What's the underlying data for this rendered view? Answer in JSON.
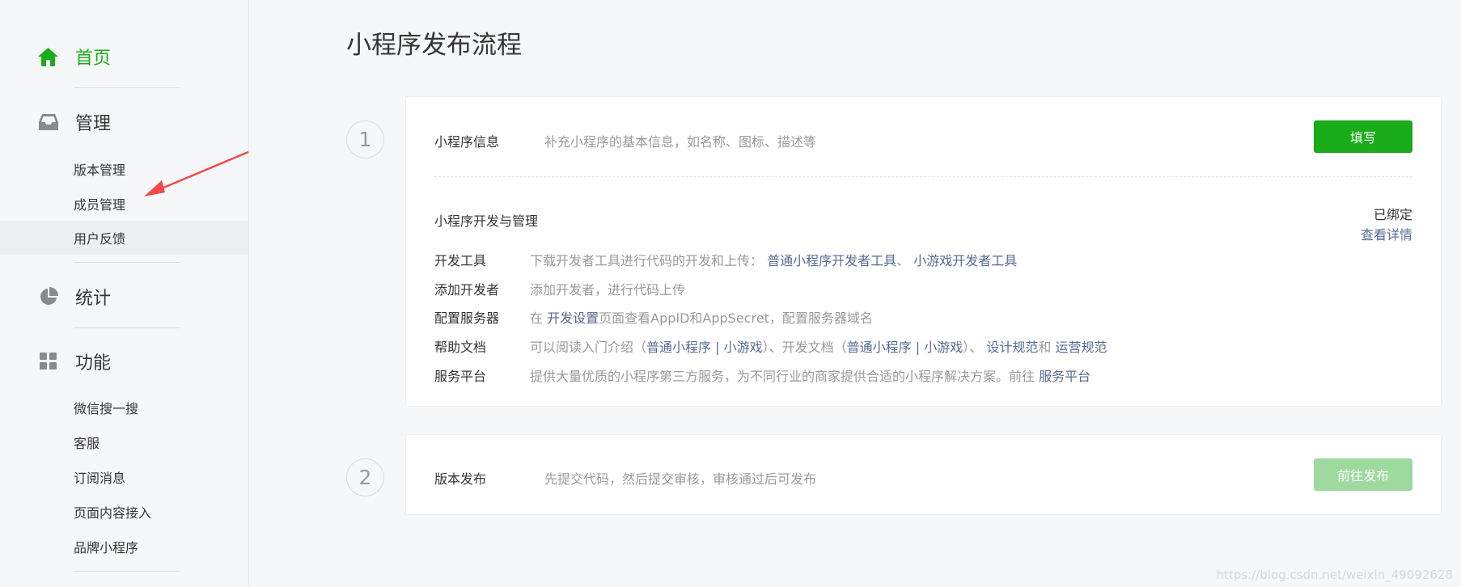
{
  "sidebar": {
    "home": {
      "label": "首页",
      "icon": "home-icon"
    },
    "manage": {
      "label": "管理",
      "icon": "inbox-icon",
      "items": [
        "版本管理",
        "成员管理",
        "用户反馈"
      ]
    },
    "stats": {
      "label": "统计",
      "icon": "pie-chart-icon"
    },
    "features": {
      "label": "功能",
      "icon": "grid-icon",
      "items": [
        "微信搜一搜",
        "客服",
        "订阅消息",
        "页面内容接入",
        "品牌小程序"
      ]
    }
  },
  "main": {
    "title": "小程序发布流程",
    "step1": {
      "number": "1",
      "title": "小程序信息",
      "desc": "补充小程序的基本信息，如名称、图标、描述等",
      "button": "填写",
      "dev": {
        "title": "小程序开发与管理",
        "status": "已绑定",
        "detail_link": "查看详情",
        "tools": {
          "key": "开发工具",
          "text": "下载开发者工具进行代码的开发和上传：",
          "link1": "普通小程序开发者工具",
          "sep": "、",
          "link2": "小游戏开发者工具"
        },
        "add_dev": {
          "key": "添加开发者",
          "text": "添加开发者，进行代码上传"
        },
        "server": {
          "key": "配置服务器",
          "pre": "在",
          "link": "开发设置",
          "post": "页面查看AppID和AppSecret，配置服务器域名"
        },
        "docs": {
          "key": "帮助文档",
          "pre": "可以阅读入门介绍（",
          "link1": "普通小程序",
          "bar1": "|",
          "link2": "小游戏",
          "mid": "）、开发文档（",
          "link3": "普通小程序",
          "bar2": "|",
          "link4": "小游戏",
          "mid2": "）、",
          "link5": "设计规范",
          "and": "和",
          "link6": "运营规范"
        },
        "platform": {
          "key": "服务平台",
          "text": "提供大量优质的小程序第三方服务，为不同行业的商家提供合适的小程序解决方案。前往",
          "link": "服务平台"
        }
      }
    },
    "step2": {
      "number": "2",
      "title": "版本发布",
      "desc": "先提交代码，然后提交审核，审核通过后可发布",
      "button": "前往发布"
    }
  },
  "watermark": "https://blog.csdn.net/weixin_49092628",
  "colors": {
    "accent": "#1aad19",
    "link": "#576b95",
    "annotation_arrow": "#f04a4a"
  }
}
